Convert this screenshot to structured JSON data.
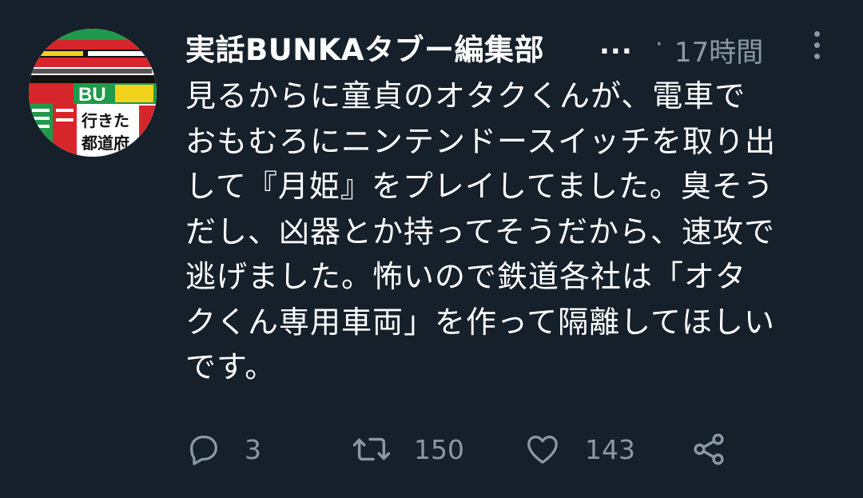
{
  "header": {
    "display_name": "実話BUNKAタブー編集部",
    "truncation": "...",
    "separator": "·",
    "timestamp": "17時間"
  },
  "avatar": {
    "headline_1": "行きた",
    "headline_2": "都道府",
    "logo_text": "BU",
    "colors": {
      "red": "#d7262b",
      "green": "#1e9a4a",
      "black": "#111111",
      "yellow": "#f3d21c"
    }
  },
  "tweet": {
    "lines": [
      "見るからに童貞のオタクくんが、電車で",
      "おもむろにニンテンドースイッチを取り出",
      "して『月姫』をプレイしてました。臭そう",
      "だし、凶器とか持ってそうだから、速攻で",
      "逃げました。怖いので鉄道各社は「オタ",
      "クくん専用車両」を作って隔離してほしい",
      "です。"
    ]
  },
  "actions": {
    "reply": {
      "icon": "reply-icon",
      "count": "3"
    },
    "retweet": {
      "icon": "retweet-icon",
      "count": "150"
    },
    "like": {
      "icon": "heart-icon",
      "count": "143"
    },
    "share": {
      "icon": "share-icon"
    }
  },
  "theme": {
    "background": "#15202b",
    "text_primary": "#ffffff",
    "text_secondary": "#8b98a5"
  }
}
